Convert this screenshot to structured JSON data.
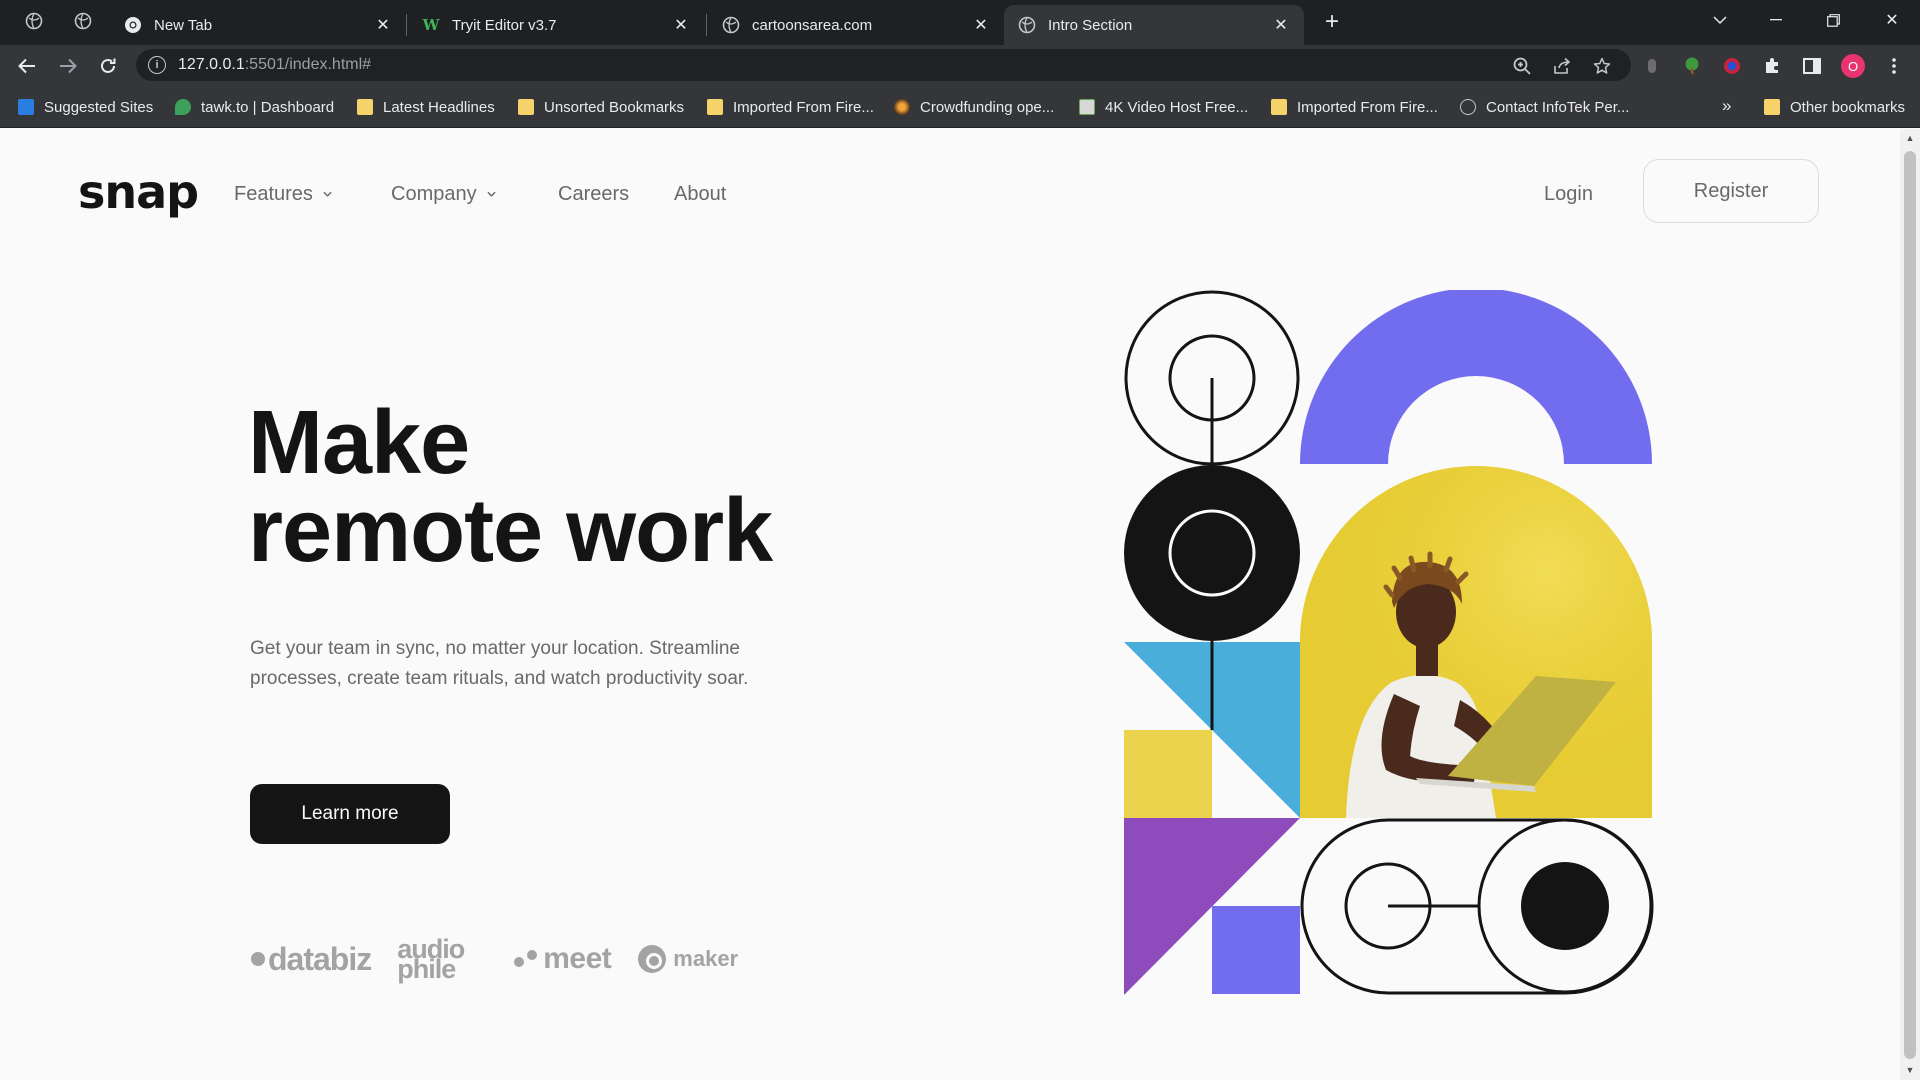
{
  "browser": {
    "tabs": [
      {
        "title": "New Tab",
        "icon": "chrome-icon"
      },
      {
        "title": "Tryit Editor v3.7",
        "icon": "w3schools-icon"
      },
      {
        "title": "cartoonsarea.com",
        "icon": "globe-icon"
      },
      {
        "title": "Intro Section",
        "icon": "globe-icon",
        "active": true
      }
    ],
    "url_host": "127.0.0.1",
    "url_path": ":5501/index.html#",
    "profile_initial": "O",
    "bookmarks": [
      {
        "label": "Suggested Sites",
        "icon": "bing-icon"
      },
      {
        "label": "tawk.to | Dashboard",
        "icon": "tawk-icon"
      },
      {
        "label": "Latest Headlines",
        "icon": "folder-icon"
      },
      {
        "label": "Unsorted Bookmarks",
        "icon": "folder-icon"
      },
      {
        "label": "Imported From Fire...",
        "icon": "folder-icon"
      },
      {
        "label": "Crowdfunding ope...",
        "icon": "crowdfunding-icon"
      },
      {
        "label": "4K Video Host Free...",
        "icon": "video-icon"
      },
      {
        "label": "Imported From Fire...",
        "icon": "folder-icon"
      },
      {
        "label": "Contact InfoTek Per...",
        "icon": "globe-icon"
      }
    ],
    "bookmarks_more": "»",
    "other_bookmarks": "Other bookmarks"
  },
  "site": {
    "logo": "snap",
    "nav": {
      "features": "Features",
      "company": "Company",
      "careers": "Careers",
      "about": "About"
    },
    "login": "Login",
    "register": "Register"
  },
  "hero": {
    "headline_line1": "Make",
    "headline_line2": "remote work",
    "subtext": "Get your team in sync, no matter your location. Streamline processes, create team rituals, and watch productivity soar.",
    "cta": "Learn more",
    "clients": [
      "databiz",
      "audiophile",
      "meet",
      "maker"
    ],
    "client_lines": {
      "audio": "audio",
      "phile": "phile"
    }
  },
  "colors": {
    "accent_purple": "#726cee",
    "accent_blue": "#4aaedb",
    "accent_yellow": "#ebd34d",
    "accent_violet": "#8d4bbb",
    "dark": "#141414",
    "muted": "#696969"
  }
}
